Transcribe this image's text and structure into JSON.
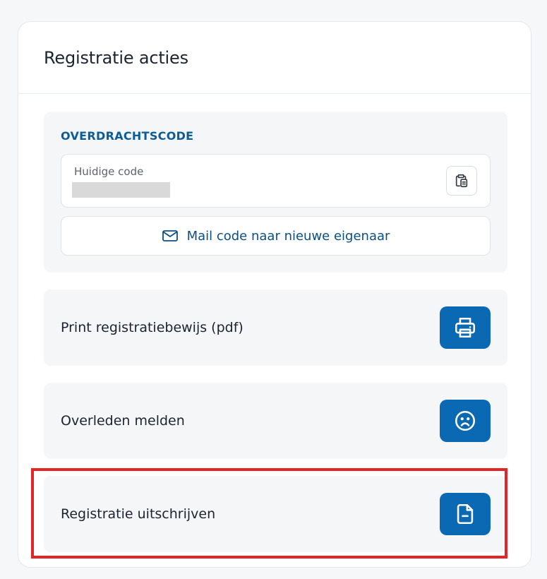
{
  "card": {
    "title": "Registratie acties"
  },
  "transfer": {
    "section_label": "OVERDRACHTSCODE",
    "code_label": "Huidige code",
    "code_value": "",
    "copy_icon": "clipboard-copy-icon",
    "mail_button_label": "Mail code naar nieuwe eigenaar",
    "mail_icon": "envelope-icon"
  },
  "actions": [
    {
      "label": "Print registratiebewijs (pdf)",
      "icon": "printer-icon"
    },
    {
      "label": "Overleden melden",
      "icon": "sad-face-icon"
    },
    {
      "label": "Registratie uitschrijven",
      "icon": "document-minus-icon"
    }
  ],
  "highlight": {
    "target": "Registratie uitschrijven",
    "color": "#e32527"
  },
  "colors": {
    "accent": "#0b68b2",
    "section_label": "#0b5c97",
    "panel_background": "#f5f6f8"
  }
}
